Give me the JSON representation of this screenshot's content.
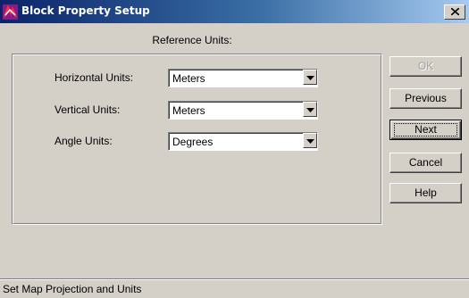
{
  "window": {
    "title": "Block Property Setup",
    "close_label": "×"
  },
  "section": {
    "title": "Reference Units:"
  },
  "units": [
    {
      "label": "Horizontal Units:",
      "value": "Meters"
    },
    {
      "label": "Vertical Units:",
      "value": "Meters"
    },
    {
      "label": "Angle Units:",
      "value": "Degrees"
    }
  ],
  "buttons": {
    "ok": {
      "label": "OK",
      "enabled": false
    },
    "previous": {
      "label": "Previous"
    },
    "next": {
      "label": "Next",
      "default": true
    },
    "cancel": {
      "label": "Cancel"
    },
    "help": {
      "label": "Help"
    }
  },
  "status": {
    "text": "Set Map Projection and Units"
  },
  "colors": {
    "face": "#d4d0c8",
    "title_start": "#0a246a",
    "title_end": "#a6caf0"
  },
  "icons": {
    "app": "app-icon",
    "close": "close-icon",
    "dropdown": "dropdown-arrow-icon"
  }
}
